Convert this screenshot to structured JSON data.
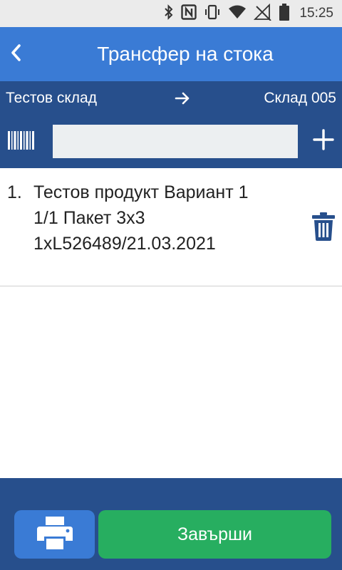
{
  "status_bar": {
    "time": "15:25",
    "icons": [
      "bluetooth-icon",
      "nfc-icon",
      "vibrate-icon",
      "wifi-icon",
      "no-signal-icon",
      "battery-icon"
    ]
  },
  "app_bar": {
    "title": "Трансфер на стока",
    "back_icon": "chevron-left-icon"
  },
  "route": {
    "from": "Тестов склад",
    "arrow_icon": "arrow-right-icon",
    "to": "Склад 005"
  },
  "scan": {
    "barcode_icon": "barcode-icon",
    "input_value": "",
    "input_placeholder": "",
    "add_icon": "plus-icon"
  },
  "items": [
    {
      "index": "1.",
      "name": "Тестов продукт Вариант 1",
      "quantity_line": "1/1 Пакет 3x3",
      "lot_line": "1xL526489/21.03.2021",
      "delete_icon": "trash-icon"
    }
  ],
  "footer": {
    "print_icon": "printer-icon",
    "finish_label": "Завърши"
  },
  "colors": {
    "app_bar": "#3a7bd5",
    "toolbar": "#274f8c",
    "finish": "#27ae60",
    "status_bar": "#ebebeb"
  }
}
